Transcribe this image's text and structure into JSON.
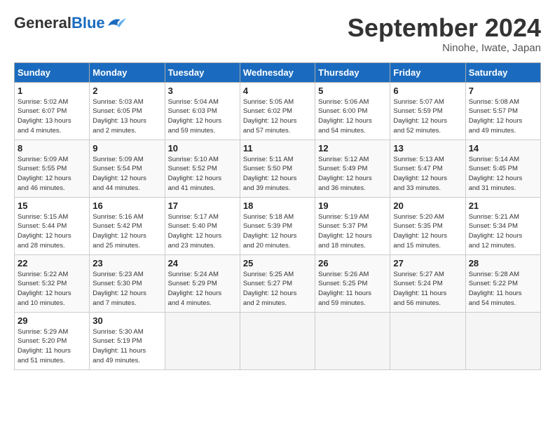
{
  "logo": {
    "general": "General",
    "blue": "Blue"
  },
  "title": "September 2024",
  "location": "Ninohe, Iwate, Japan",
  "weekdays": [
    "Sunday",
    "Monday",
    "Tuesday",
    "Wednesday",
    "Thursday",
    "Friday",
    "Saturday"
  ],
  "weeks": [
    [
      {
        "day": "1",
        "info": "Sunrise: 5:02 AM\nSunset: 6:07 PM\nDaylight: 13 hours\nand 4 minutes."
      },
      {
        "day": "2",
        "info": "Sunrise: 5:03 AM\nSunset: 6:05 PM\nDaylight: 13 hours\nand 2 minutes."
      },
      {
        "day": "3",
        "info": "Sunrise: 5:04 AM\nSunset: 6:03 PM\nDaylight: 12 hours\nand 59 minutes."
      },
      {
        "day": "4",
        "info": "Sunrise: 5:05 AM\nSunset: 6:02 PM\nDaylight: 12 hours\nand 57 minutes."
      },
      {
        "day": "5",
        "info": "Sunrise: 5:06 AM\nSunset: 6:00 PM\nDaylight: 12 hours\nand 54 minutes."
      },
      {
        "day": "6",
        "info": "Sunrise: 5:07 AM\nSunset: 5:59 PM\nDaylight: 12 hours\nand 52 minutes."
      },
      {
        "day": "7",
        "info": "Sunrise: 5:08 AM\nSunset: 5:57 PM\nDaylight: 12 hours\nand 49 minutes."
      }
    ],
    [
      {
        "day": "8",
        "info": "Sunrise: 5:09 AM\nSunset: 5:55 PM\nDaylight: 12 hours\nand 46 minutes."
      },
      {
        "day": "9",
        "info": "Sunrise: 5:09 AM\nSunset: 5:54 PM\nDaylight: 12 hours\nand 44 minutes."
      },
      {
        "day": "10",
        "info": "Sunrise: 5:10 AM\nSunset: 5:52 PM\nDaylight: 12 hours\nand 41 minutes."
      },
      {
        "day": "11",
        "info": "Sunrise: 5:11 AM\nSunset: 5:50 PM\nDaylight: 12 hours\nand 39 minutes."
      },
      {
        "day": "12",
        "info": "Sunrise: 5:12 AM\nSunset: 5:49 PM\nDaylight: 12 hours\nand 36 minutes."
      },
      {
        "day": "13",
        "info": "Sunrise: 5:13 AM\nSunset: 5:47 PM\nDaylight: 12 hours\nand 33 minutes."
      },
      {
        "day": "14",
        "info": "Sunrise: 5:14 AM\nSunset: 5:45 PM\nDaylight: 12 hours\nand 31 minutes."
      }
    ],
    [
      {
        "day": "15",
        "info": "Sunrise: 5:15 AM\nSunset: 5:44 PM\nDaylight: 12 hours\nand 28 minutes."
      },
      {
        "day": "16",
        "info": "Sunrise: 5:16 AM\nSunset: 5:42 PM\nDaylight: 12 hours\nand 25 minutes."
      },
      {
        "day": "17",
        "info": "Sunrise: 5:17 AM\nSunset: 5:40 PM\nDaylight: 12 hours\nand 23 minutes."
      },
      {
        "day": "18",
        "info": "Sunrise: 5:18 AM\nSunset: 5:39 PM\nDaylight: 12 hours\nand 20 minutes."
      },
      {
        "day": "19",
        "info": "Sunrise: 5:19 AM\nSunset: 5:37 PM\nDaylight: 12 hours\nand 18 minutes."
      },
      {
        "day": "20",
        "info": "Sunrise: 5:20 AM\nSunset: 5:35 PM\nDaylight: 12 hours\nand 15 minutes."
      },
      {
        "day": "21",
        "info": "Sunrise: 5:21 AM\nSunset: 5:34 PM\nDaylight: 12 hours\nand 12 minutes."
      }
    ],
    [
      {
        "day": "22",
        "info": "Sunrise: 5:22 AM\nSunset: 5:32 PM\nDaylight: 12 hours\nand 10 minutes."
      },
      {
        "day": "23",
        "info": "Sunrise: 5:23 AM\nSunset: 5:30 PM\nDaylight: 12 hours\nand 7 minutes."
      },
      {
        "day": "24",
        "info": "Sunrise: 5:24 AM\nSunset: 5:29 PM\nDaylight: 12 hours\nand 4 minutes."
      },
      {
        "day": "25",
        "info": "Sunrise: 5:25 AM\nSunset: 5:27 PM\nDaylight: 12 hours\nand 2 minutes."
      },
      {
        "day": "26",
        "info": "Sunrise: 5:26 AM\nSunset: 5:25 PM\nDaylight: 11 hours\nand 59 minutes."
      },
      {
        "day": "27",
        "info": "Sunrise: 5:27 AM\nSunset: 5:24 PM\nDaylight: 11 hours\nand 56 minutes."
      },
      {
        "day": "28",
        "info": "Sunrise: 5:28 AM\nSunset: 5:22 PM\nDaylight: 11 hours\nand 54 minutes."
      }
    ],
    [
      {
        "day": "29",
        "info": "Sunrise: 5:29 AM\nSunset: 5:20 PM\nDaylight: 11 hours\nand 51 minutes."
      },
      {
        "day": "30",
        "info": "Sunrise: 5:30 AM\nSunset: 5:19 PM\nDaylight: 11 hours\nand 49 minutes."
      },
      {
        "day": "",
        "info": ""
      },
      {
        "day": "",
        "info": ""
      },
      {
        "day": "",
        "info": ""
      },
      {
        "day": "",
        "info": ""
      },
      {
        "day": "",
        "info": ""
      }
    ]
  ]
}
